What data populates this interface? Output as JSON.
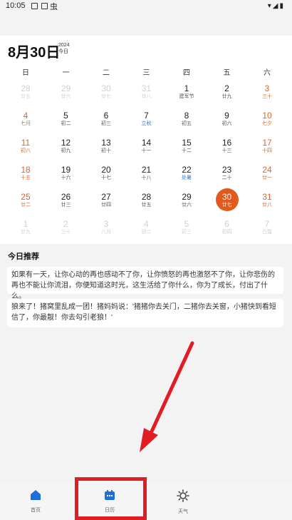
{
  "status_bar": {
    "time": "10:05",
    "bug_glyph": "虫",
    "signal_glyphs": "▾◢▮"
  },
  "header": {
    "date_title": "8月30日",
    "year": "2024",
    "today_label": "今日"
  },
  "weekdays": [
    "日",
    "一",
    "二",
    "三",
    "四",
    "五",
    "六"
  ],
  "days": [
    {
      "num": "28",
      "lunar": "廿五",
      "state": "dim"
    },
    {
      "num": "29",
      "lunar": "廿六",
      "state": "dim"
    },
    {
      "num": "30",
      "lunar": "廿七",
      "state": "dim"
    },
    {
      "num": "31",
      "lunar": "廿八",
      "state": "dim"
    },
    {
      "num": "1",
      "lunar": "建军节",
      "state": "normal"
    },
    {
      "num": "2",
      "lunar": "廿九",
      "state": "normal"
    },
    {
      "num": "3",
      "lunar": "三十",
      "state": "weekend"
    },
    {
      "num": "4",
      "lunar": "七月",
      "state": "weekend"
    },
    {
      "num": "5",
      "lunar": "初二",
      "state": "normal"
    },
    {
      "num": "6",
      "lunar": "初三",
      "state": "normal"
    },
    {
      "num": "7",
      "lunar": "立秋",
      "state": "term"
    },
    {
      "num": "8",
      "lunar": "初五",
      "state": "normal"
    },
    {
      "num": "9",
      "lunar": "初六",
      "state": "normal"
    },
    {
      "num": "10",
      "lunar": "七夕",
      "state": "weekend"
    },
    {
      "num": "11",
      "lunar": "初八",
      "state": "weekend"
    },
    {
      "num": "12",
      "lunar": "初九",
      "state": "normal"
    },
    {
      "num": "13",
      "lunar": "初十",
      "state": "normal"
    },
    {
      "num": "14",
      "lunar": "十一",
      "state": "normal"
    },
    {
      "num": "15",
      "lunar": "十二",
      "state": "normal"
    },
    {
      "num": "16",
      "lunar": "十三",
      "state": "normal"
    },
    {
      "num": "17",
      "lunar": "十四",
      "state": "weekend"
    },
    {
      "num": "18",
      "lunar": "十五",
      "state": "weekend"
    },
    {
      "num": "19",
      "lunar": "十六",
      "state": "normal"
    },
    {
      "num": "20",
      "lunar": "十七",
      "state": "normal"
    },
    {
      "num": "21",
      "lunar": "十八",
      "state": "normal"
    },
    {
      "num": "22",
      "lunar": "处暑",
      "state": "term"
    },
    {
      "num": "23",
      "lunar": "二十",
      "state": "normal"
    },
    {
      "num": "24",
      "lunar": "廿一",
      "state": "weekend"
    },
    {
      "num": "25",
      "lunar": "廿二",
      "state": "weekend"
    },
    {
      "num": "26",
      "lunar": "廿三",
      "state": "normal"
    },
    {
      "num": "27",
      "lunar": "廿四",
      "state": "normal"
    },
    {
      "num": "28",
      "lunar": "廿五",
      "state": "normal"
    },
    {
      "num": "29",
      "lunar": "廿六",
      "state": "normal"
    },
    {
      "num": "30",
      "lunar": "廿七",
      "state": "selected"
    },
    {
      "num": "31",
      "lunar": "廿八",
      "state": "weekend"
    },
    {
      "num": "1",
      "lunar": "廿九",
      "state": "dim"
    },
    {
      "num": "2",
      "lunar": "三十",
      "state": "dim"
    },
    {
      "num": "3",
      "lunar": "八月",
      "state": "dim"
    },
    {
      "num": "4",
      "lunar": "初二",
      "state": "dim"
    },
    {
      "num": "5",
      "lunar": "初三",
      "state": "dim"
    },
    {
      "num": "6",
      "lunar": "初四",
      "state": "dim"
    },
    {
      "num": "7",
      "lunar": "白露",
      "state": "dim"
    }
  ],
  "recommend": {
    "title": "今日推荐",
    "card1": "如果有一天，让你心动的再也感动不了你，让你愤怒的再也激怒不了你，让你悲伤的再也不能让你流泪，你便知道这时光，这生活给了你什么，你为了成长，付出了什么。",
    "card2": "狼来了！猪窝里乱成一团！猪妈妈说：'猪猪你去关门，二猪你去关窗，小猪快到看短信了，你最靓！你去勾引老狼！'"
  },
  "bottom_nav": [
    {
      "label": "首页",
      "icon": "home-icon"
    },
    {
      "label": "日历",
      "icon": "calendar-icon"
    },
    {
      "label": "天气",
      "icon": "weather-sun-icon"
    }
  ],
  "colors": {
    "accent": "#e05a1e",
    "weekend": "#e0652a",
    "term": "#2d7bd8",
    "annotation": "#e01d24",
    "nav_blue": "#1e6fd9"
  }
}
